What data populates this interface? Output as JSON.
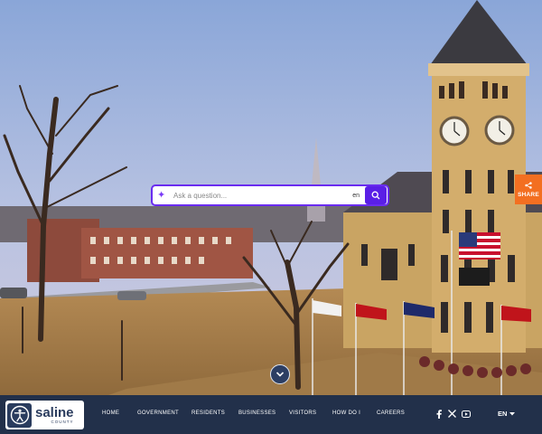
{
  "search": {
    "placeholder": "Ask a question...",
    "language_badge": "en"
  },
  "share": {
    "label": "SHARE"
  },
  "logo": {
    "name": "saline",
    "subtitle": "COUNTY"
  },
  "nav": {
    "items": [
      "HOME",
      "GOVERNMENT",
      "RESIDENTS",
      "BUSINESSES",
      "VISITORS",
      "HOW DO I",
      "CAREERS"
    ]
  },
  "social": [
    "facebook-icon",
    "x-icon",
    "youtube-icon"
  ],
  "language": {
    "current": "EN"
  },
  "colors": {
    "footer": "#22304a",
    "search_accent": "#5a1fe6",
    "share_tab": "#f36f21"
  }
}
